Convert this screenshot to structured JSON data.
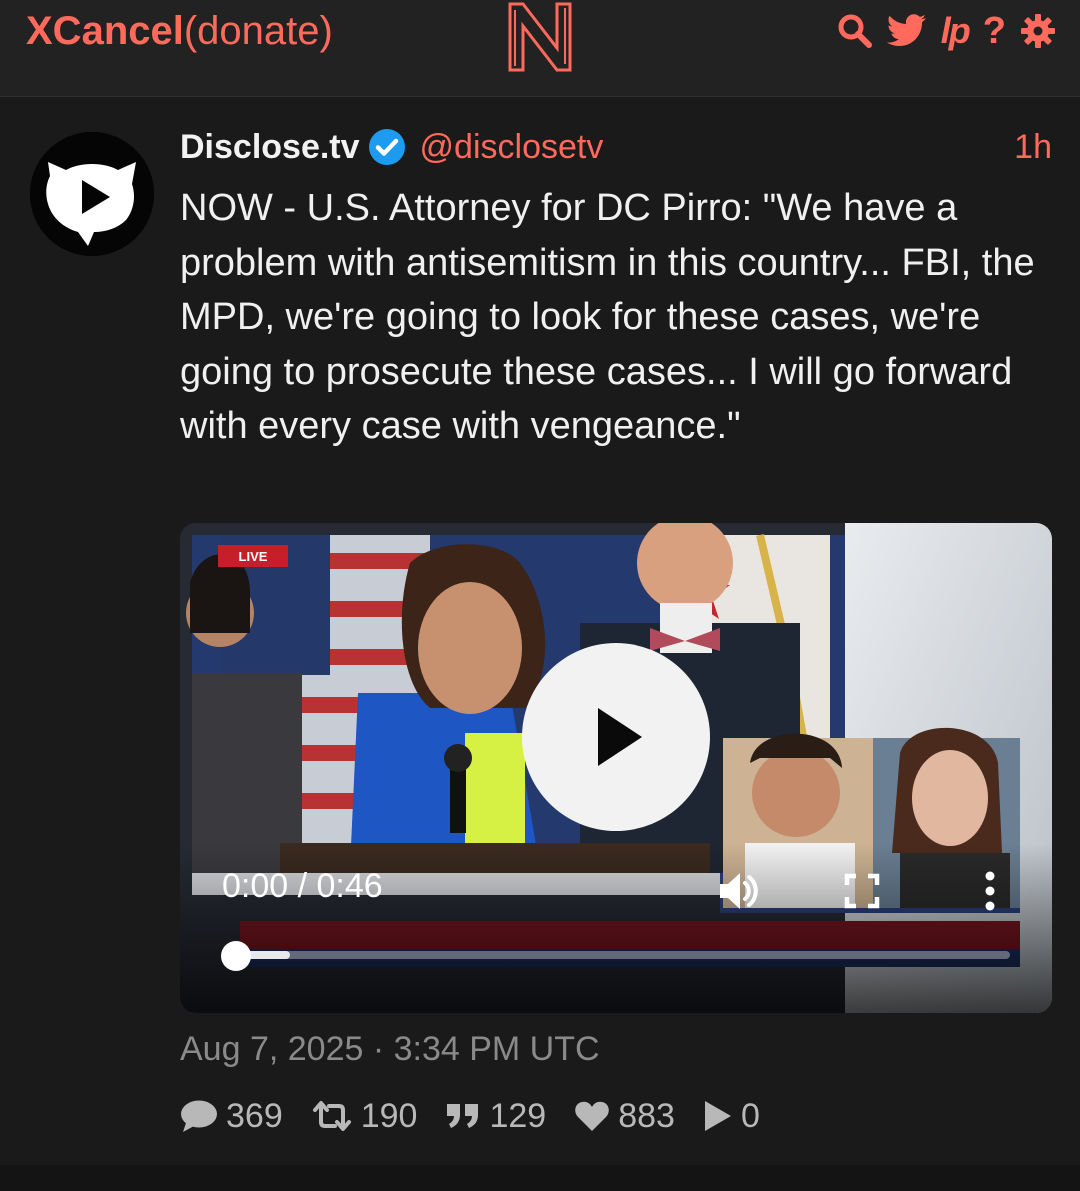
{
  "header": {
    "brand_main": "XCancel",
    "brand_sub": "(donate)",
    "nav": [
      "search-icon",
      "twitter-bird-icon",
      "lp-icon",
      "help-icon",
      "settings-gear-icon"
    ],
    "help_glyph": "?",
    "lp_glyph": "lp",
    "accent_color": "#ff6a5c"
  },
  "tweet": {
    "author_name": "Disclose.tv",
    "verified": true,
    "handle": "@disclosetv",
    "time_ago": "1h",
    "text": "NOW - U.S. Attorney for DC Pirro: \"We have a problem with antisemitism in this country... FBI, the MPD, we're going to look for these cases, we're going to prosecute these cases... I will go forward with every case with vengeance.\"",
    "date": "Aug 7, 2025 · 3:34 PM UTC",
    "video": {
      "time_display": "0:00 / 0:46",
      "played_fraction": 0.0,
      "buffered_fraction": 0.07
    },
    "stats": {
      "replies": "369",
      "retweets": "190",
      "quotes": "129",
      "likes": "883",
      "views": "0"
    }
  }
}
